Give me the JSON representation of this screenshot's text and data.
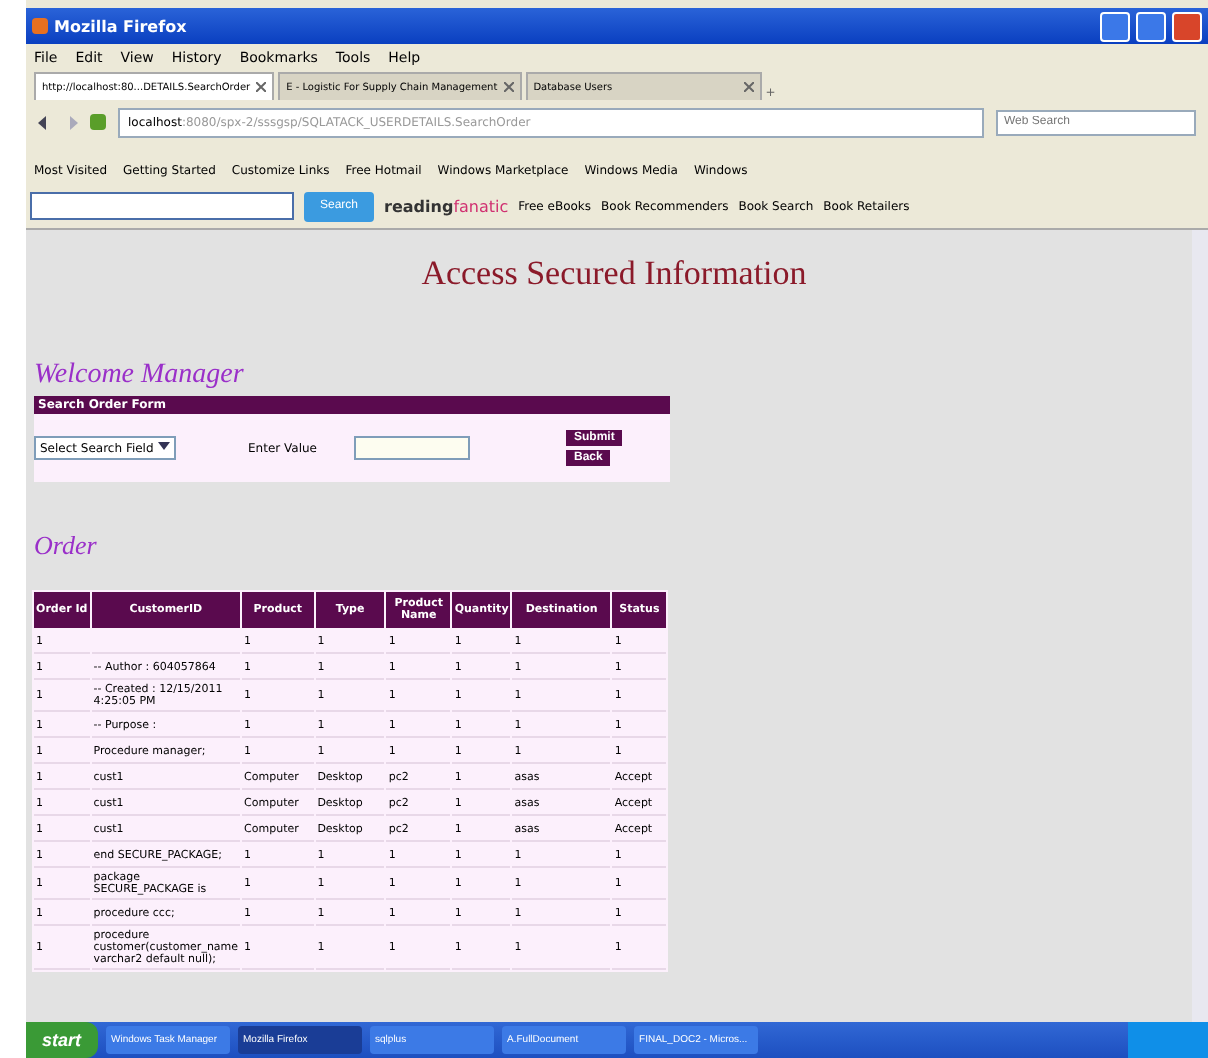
{
  "window": {
    "title": "Mozilla Firefox"
  },
  "menu": [
    "File",
    "Edit",
    "View",
    "History",
    "Bookmarks",
    "Tools",
    "Help"
  ],
  "tabs": [
    {
      "label": "http://localhost:80...DETAILS.SearchOrder",
      "selected": true
    },
    {
      "label": "E - Logistic For Supply Chain Management",
      "selected": false
    },
    {
      "label": "Database Users",
      "selected": false
    }
  ],
  "new_tab": "+",
  "address": {
    "host": "localhost",
    "path": ":8080/spx-2/sssgsp/SQLATACK_USERDETAILS.SearchOrder"
  },
  "web_search": {
    "placeholder": "Web Search"
  },
  "bookmarks": [
    "Most Visited",
    "Getting Started",
    "Customize Links",
    "Free Hotmail",
    "Windows Marketplace",
    "Windows Media",
    "Windows"
  ],
  "search_toolbar": {
    "button": "Search",
    "brand_a": "reading",
    "brand_b": "fanatic",
    "links": [
      "Free eBooks",
      "Book Recommenders",
      "Book Search",
      "Book Retailers"
    ]
  },
  "page": {
    "title": "Access Secured Information",
    "welcome": "Welcome Manager",
    "form": {
      "header": "Search Order Form",
      "select": "Select Search Field",
      "value_label": "Enter Value",
      "buttons": [
        "Submit",
        "Back"
      ]
    },
    "order_heading": "Order",
    "table": {
      "columns": [
        "Order Id",
        "CustomerID",
        "Product",
        "Type",
        "Product Name",
        "Quantity",
        "Destination",
        "Status"
      ],
      "rows": [
        [
          "1",
          "",
          "1",
          "1",
          "1",
          "1",
          "1",
          "1"
        ],
        [
          "1",
          "-- Author : 604057864",
          "1",
          "1",
          "1",
          "1",
          "1",
          "1"
        ],
        [
          "1",
          "-- Created : 12/15/2011 4:25:05 PM",
          "1",
          "1",
          "1",
          "1",
          "1",
          "1"
        ],
        [
          "1",
          "-- Purpose :",
          "1",
          "1",
          "1",
          "1",
          "1",
          "1"
        ],
        [
          "1",
          "Procedure manager;",
          "1",
          "1",
          "1",
          "1",
          "1",
          "1"
        ],
        [
          "1",
          "cust1",
          "Computer",
          "Desktop",
          "pc2",
          "1",
          "asas",
          "Accept"
        ],
        [
          "1",
          "cust1",
          "Computer",
          "Desktop",
          "pc2",
          "1",
          "asas",
          "Accept"
        ],
        [
          "1",
          "cust1",
          "Computer",
          "Desktop",
          "pc2",
          "1",
          "asas",
          "Accept"
        ],
        [
          "1",
          "end SECURE_PACKAGE;",
          "1",
          "1",
          "1",
          "1",
          "1",
          "1"
        ],
        [
          "1",
          "package SECURE_PACKAGE is",
          "1",
          "1",
          "1",
          "1",
          "1",
          "1"
        ],
        [
          "1",
          "procedure ccc;",
          "1",
          "1",
          "1",
          "1",
          "1",
          "1"
        ],
        [
          "1",
          "procedure customer(customer_name varchar2 default null);",
          "1",
          "1",
          "1",
          "1",
          "1",
          "1"
        ]
      ]
    }
  },
  "taskbar": {
    "start": "start",
    "items": [
      {
        "label": "Windows Task Manager",
        "selected": false
      },
      {
        "label": "Mozilla Firefox",
        "selected": true
      },
      {
        "label": "sqlplus",
        "selected": false
      },
      {
        "label": "A.FullDocument",
        "selected": false
      },
      {
        "label": "FINAL_DOC2 - Micros...",
        "selected": false
      }
    ]
  }
}
